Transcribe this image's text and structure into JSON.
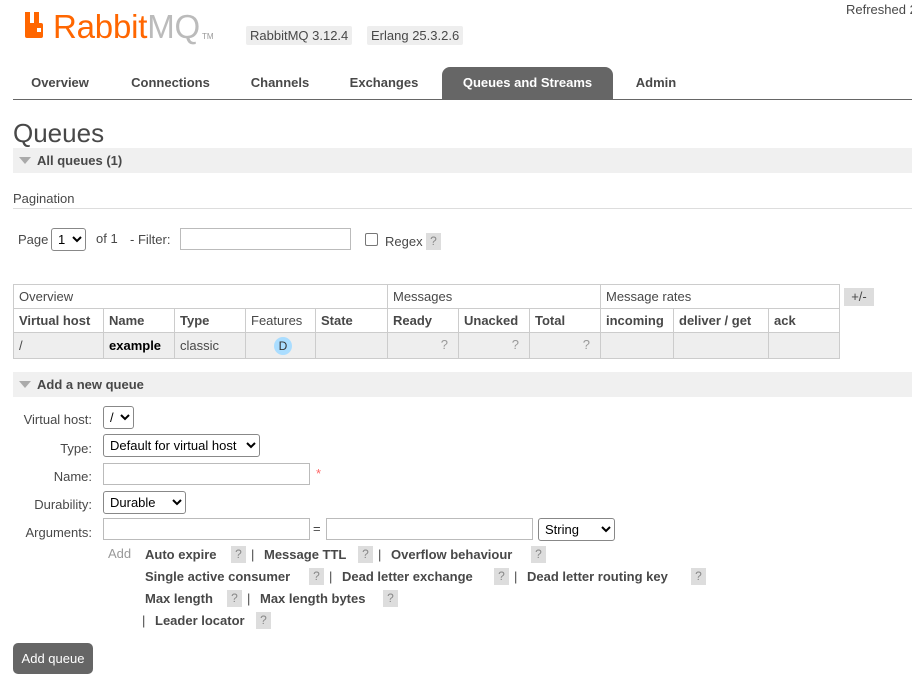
{
  "header": {
    "logo_primary": "Rabbit",
    "logo_secondary": "MQ",
    "logo_tm": "TM",
    "version_rabbitmq": "RabbitMQ 3.12.4",
    "version_erlang": "Erlang 25.3.2.6",
    "refreshed": "Refreshed 2"
  },
  "tabs": [
    {
      "label": "Overview"
    },
    {
      "label": "Connections"
    },
    {
      "label": "Channels"
    },
    {
      "label": "Exchanges"
    },
    {
      "label": "Queues and Streams",
      "active": true
    },
    {
      "label": "Admin"
    }
  ],
  "page_title": "Queues",
  "all_queues": {
    "label": "All queues (1)"
  },
  "pagination": {
    "label": "Pagination",
    "page_label": "Page",
    "page_value": "1",
    "of_label": "of 1",
    "filter_label": "- Filter:",
    "filter_value": "",
    "regex_label": "Regex",
    "help": "?"
  },
  "table": {
    "groups": [
      "Overview",
      "Messages",
      "Message rates"
    ],
    "plus_minus": "+/-",
    "columns": [
      "Virtual host",
      "Name",
      "Type",
      "Features",
      "State",
      "Ready",
      "Unacked",
      "Total",
      "incoming",
      "deliver / get",
      "ack"
    ],
    "rows": [
      {
        "vhost": "/",
        "name": "example",
        "type": "classic",
        "feature": "D",
        "state": "",
        "ready": "?",
        "unacked": "?",
        "total": "?",
        "incoming": "",
        "deliver_get": "",
        "ack": ""
      }
    ]
  },
  "add_queue": {
    "section_label": "Add a new queue",
    "vhost_label": "Virtual host:",
    "vhost_value": "/",
    "type_label": "Type:",
    "type_value": "Default for virtual host",
    "name_label": "Name:",
    "name_value": "",
    "required_mark": "*",
    "durability_label": "Durability:",
    "durability_value": "Durable",
    "arguments_label": "Arguments:",
    "equals": "=",
    "arg_type_value": "String",
    "add_label": "Add",
    "arg_keys": [
      "Auto expire",
      "Message TTL",
      "Overflow behaviour",
      "Single active consumer",
      "Dead letter exchange",
      "Dead letter routing key",
      "Max length",
      "Max length bytes",
      "Leader locator"
    ],
    "pipe": "|",
    "help": "?",
    "submit_label": "Add queue"
  },
  "colors": {
    "brand_orange": "#ff6600",
    "tab_active": "#666666",
    "feature_badge": "#aaddff",
    "required": "#ff6666"
  }
}
